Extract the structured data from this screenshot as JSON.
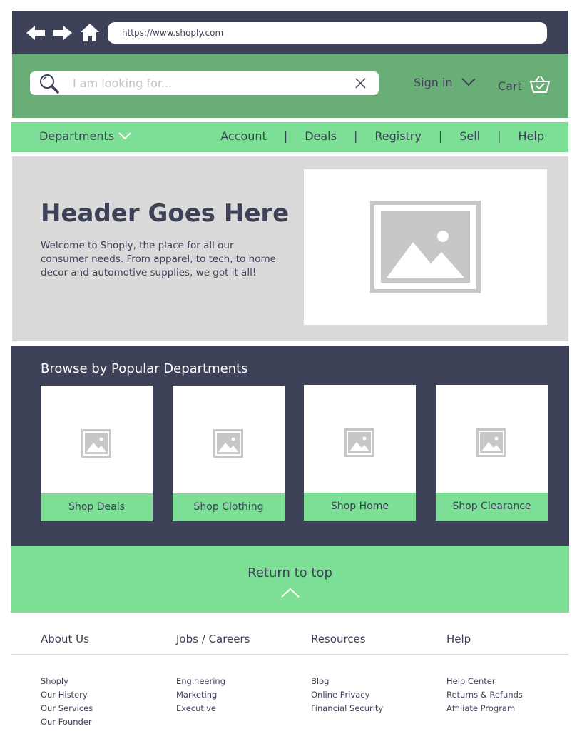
{
  "browser": {
    "url": "https://www.shoply.com",
    "icons": [
      "back-arrow-icon",
      "forward-arrow-icon",
      "home-icon"
    ]
  },
  "header": {
    "search_placeholder": "I am looking for...",
    "signin_label": "Sign in",
    "cart_label": "Cart"
  },
  "nav": {
    "departments_label": "Departments",
    "links": [
      "Account",
      "Deals",
      "Registry",
      "Sell",
      "Help"
    ],
    "separator": "|"
  },
  "hero": {
    "title": "Header Goes Here",
    "text": "Welcome to Shoply, the place for all our consumer needs. From apparel, to tech, to home decor and automotive supplies, we got it all!"
  },
  "browse": {
    "title": "Browse by Popular Departments",
    "cards": [
      "Shop Deals",
      "Shop Clothing",
      "Shop Home",
      "Shop Clearance"
    ]
  },
  "return_top": {
    "label": "Return to top"
  },
  "footer": {
    "columns": [
      {
        "heading": "About Us",
        "links": [
          "Shoply",
          "Our History",
          "Our Services",
          "Our Founder"
        ]
      },
      {
        "heading": "Jobs / Careers",
        "links": [
          "Engineering",
          "Marketing",
          "Executive"
        ]
      },
      {
        "heading": "Resources",
        "links": [
          "Blog",
          "Online Privacy",
          "Financial Security"
        ]
      },
      {
        "heading": "Help",
        "links": [
          "Help Center",
          "Returns & Refunds",
          "Affiliate Program"
        ]
      }
    ]
  },
  "colors": {
    "dark": "#3e4259",
    "green": "#68ae76",
    "light_green": "#7ddf96",
    "gray": "#dadada",
    "placeholder_gray": "#c7c7c7"
  }
}
